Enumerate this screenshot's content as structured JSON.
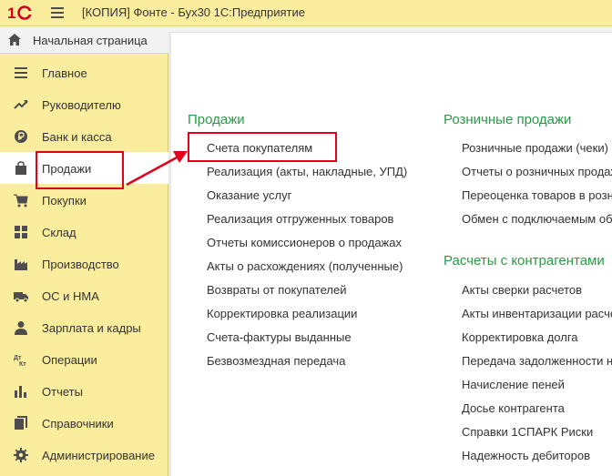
{
  "window": {
    "title": "[КОПИЯ] Фонте - Бух30 1С:Предприятие"
  },
  "sidebar": {
    "home": {
      "label": "Начальная страница",
      "icon": "home-icon"
    },
    "items": [
      {
        "label": "Главное",
        "icon": "menu-lines-icon"
      },
      {
        "label": "Руководителю",
        "icon": "trend-up-icon"
      },
      {
        "label": "Банк и касса",
        "icon": "ruble-coin-icon"
      },
      {
        "label": "Продажи",
        "icon": "shopping-bag-icon",
        "active": true
      },
      {
        "label": "Покупки",
        "icon": "shopping-cart-icon"
      },
      {
        "label": "Склад",
        "icon": "warehouse-grid-icon"
      },
      {
        "label": "Производство",
        "icon": "factory-icon"
      },
      {
        "label": "ОС и НМА",
        "icon": "truck-icon"
      },
      {
        "label": "Зарплата и кадры",
        "icon": "person-icon"
      },
      {
        "label": "Операции",
        "icon": "debit-credit-icon"
      },
      {
        "label": "Отчеты",
        "icon": "bar-chart-icon"
      },
      {
        "label": "Справочники",
        "icon": "books-icon"
      },
      {
        "label": "Администрирование",
        "icon": "gear-icon"
      }
    ]
  },
  "sections": {
    "sales": {
      "title": "Продажи",
      "links": [
        "Счета покупателям",
        "Реализация (акты, накладные, УПД)",
        "Оказание услуг",
        "Реализация отгруженных товаров",
        "Отчеты комиссионеров о продажах",
        "Акты о расхождениях (полученные)",
        "Возвраты от покупателей",
        "Корректировка реализации",
        "Счета-фактуры выданные",
        "Безвозмездная передача"
      ]
    },
    "retail": {
      "title": "Розничные продажи",
      "links": [
        "Розничные продажи (чеки)",
        "Отчеты о розничных продаж",
        "Переоценка товаров в розн",
        "Обмен с подключаемым об"
      ]
    },
    "counterparties": {
      "title": "Расчеты с контрагентами",
      "links": [
        "Акты сверки расчетов",
        "Акты инвентаризации расче",
        "Корректировка долга",
        "Передача задолженности н",
        "Начисление пеней",
        "Досье контрагента",
        "Справки 1СПАРК Риски",
        "Надежность дебиторов"
      ]
    }
  },
  "colors": {
    "panel": "#fbed9e",
    "section_title": "#2a9a46",
    "highlight": "#e2001a"
  }
}
